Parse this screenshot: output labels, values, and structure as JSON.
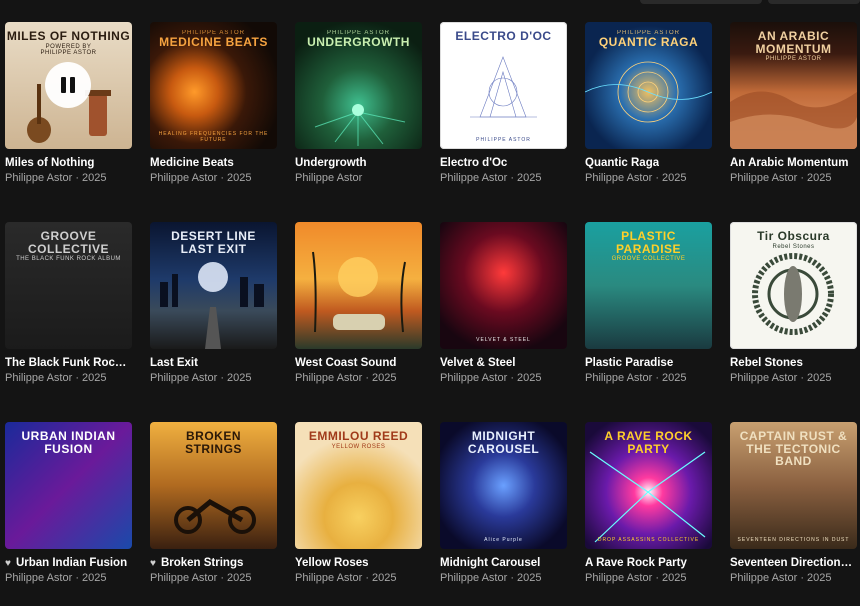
{
  "albums": [
    {
      "title": "Miles of Nothing",
      "meta": "Philippe Astor · 2025",
      "liked": false,
      "playing": true,
      "cover": {
        "top": "",
        "title": "MILES OF NOTHING",
        "sub": "POWERED BY\nPHILIPPE ASTOR",
        "bottom": ""
      }
    },
    {
      "title": "Medicine Beats",
      "meta": "Philippe Astor · 2025",
      "liked": false,
      "playing": false,
      "cover": {
        "top": "PHILIPPE ASTOR",
        "title": "MEDICINE BEATS",
        "sub": "",
        "bottom": "HEALING FREQUENCIES FOR THE FUTURE"
      }
    },
    {
      "title": "Undergrowth",
      "meta": "Philippe Astor",
      "liked": false,
      "playing": false,
      "cover": {
        "top": "PHILIPPE ASTOR",
        "title": "UNDERGROWTH",
        "sub": "",
        "bottom": ""
      }
    },
    {
      "title": "Electro d'Oc",
      "meta": "Philippe Astor · 2025",
      "liked": false,
      "playing": false,
      "cover": {
        "top": "",
        "title": "ELECTRO D'OC",
        "sub": "",
        "bottom": "PHILIPPE ASTOR"
      }
    },
    {
      "title": "Quantic Raga",
      "meta": "Philippe Astor · 2025",
      "liked": false,
      "playing": false,
      "cover": {
        "top": "PHILIPPE ASTOR",
        "title": "QUANTIC RAGA",
        "sub": "",
        "bottom": ""
      }
    },
    {
      "title": "An Arabic Momentum",
      "meta": "Philippe Astor · 2025",
      "liked": false,
      "playing": false,
      "cover": {
        "top": "",
        "title": "AN ARABIC MOMENTUM",
        "sub": "PHILIPPE ASTOR",
        "bottom": ""
      }
    },
    {
      "title": "The Black Funk Rock Album",
      "meta": "Philippe Astor · 2025",
      "liked": false,
      "playing": false,
      "cover": {
        "top": "",
        "title": "GROOVE COLLECTIVE",
        "sub": "THE BLACK FUNK ROCK ALBUM",
        "bottom": ""
      }
    },
    {
      "title": "Last Exit",
      "meta": "Philippe Astor · 2025",
      "liked": false,
      "playing": false,
      "cover": {
        "top": "",
        "title": "DESERT LINE\nLAST EXIT",
        "sub": "",
        "bottom": ""
      }
    },
    {
      "title": "West Coast Sound",
      "meta": "Philippe Astor · 2025",
      "liked": false,
      "playing": false,
      "cover": {
        "top": "",
        "title": "",
        "sub": "",
        "bottom": ""
      }
    },
    {
      "title": "Velvet & Steel",
      "meta": "Philippe Astor · 2025",
      "liked": false,
      "playing": false,
      "cover": {
        "top": "",
        "title": "",
        "sub": "",
        "bottom": "VELVET & STEEL"
      }
    },
    {
      "title": "Plastic Paradise",
      "meta": "Philippe Astor · 2025",
      "liked": false,
      "playing": false,
      "cover": {
        "top": "",
        "title": "PLASTIC\nPARADISE",
        "sub": "GROOVE COLLECTIVE",
        "bottom": ""
      }
    },
    {
      "title": "Rebel Stones",
      "meta": "Philippe Astor · 2025",
      "liked": false,
      "playing": false,
      "cover": {
        "top": "",
        "title": "Tir Obscura",
        "sub": "Rebel Stones",
        "bottom": ""
      }
    },
    {
      "title": "Urban Indian Fusion",
      "meta": "Philippe Astor · 2025",
      "liked": true,
      "playing": false,
      "cover": {
        "top": "",
        "title": "URBAN INDIAN\nFUSION",
        "sub": "",
        "bottom": ""
      }
    },
    {
      "title": "Broken Strings",
      "meta": "Philippe Astor · 2025",
      "liked": true,
      "playing": false,
      "cover": {
        "top": "",
        "title": "BROKEN\nSTRINGS",
        "sub": "",
        "bottom": ""
      }
    },
    {
      "title": "Yellow Roses",
      "meta": "Philippe Astor · 2025",
      "liked": false,
      "playing": false,
      "cover": {
        "top": "",
        "title": "EMMILOU REED",
        "sub": "YELLOW ROSES",
        "bottom": ""
      }
    },
    {
      "title": "Midnight Carousel",
      "meta": "Philippe Astor · 2025",
      "liked": false,
      "playing": false,
      "cover": {
        "top": "",
        "title": "MIDNIGHT CAROUSEL",
        "sub": "",
        "bottom": "Alice Purple"
      }
    },
    {
      "title": "A Rave Rock Party",
      "meta": "Philippe Astor · 2025",
      "liked": false,
      "playing": false,
      "cover": {
        "top": "",
        "title": "A RAVE ROCK PARTY",
        "sub": "",
        "bottom": "DROP ASSASSINS COLLECTIVE"
      }
    },
    {
      "title": "Seventeen Directions in Dust",
      "meta": "Philippe Astor · 2025",
      "liked": false,
      "playing": false,
      "cover": {
        "top": "",
        "title": "CAPTAIN RUST & THE TECTONIC BAND",
        "sub": "",
        "bottom": "SEVENTEEN DIRECTIONS IN DUST"
      }
    }
  ],
  "icons": {
    "pause": "pause-icon",
    "heart": "heart-icon"
  },
  "colors": {
    "background": "#141414",
    "text": "#ffffff",
    "subtext": "#a7a7a7"
  }
}
